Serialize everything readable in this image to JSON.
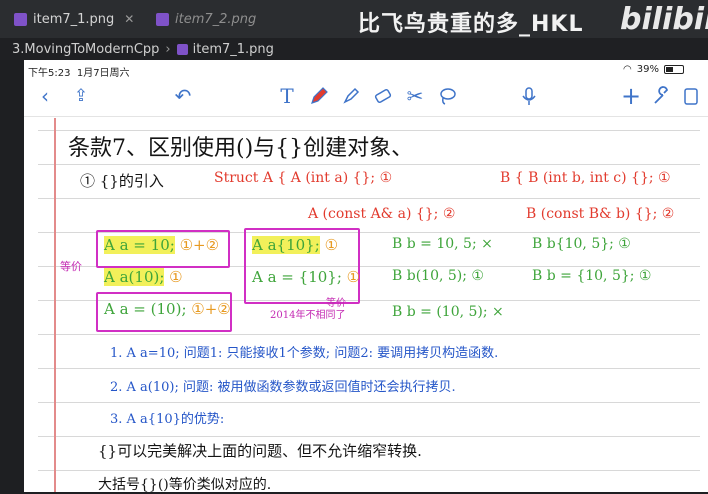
{
  "editor": {
    "tabs": [
      {
        "label": "item7_1.png",
        "active": true
      },
      {
        "label": "item7_2.png",
        "active": false
      }
    ],
    "breadcrumb": [
      "3.MovingToModernCpp",
      "item7_1.png"
    ],
    "watermark": "比飞鸟贵重的多_HKL",
    "logo": "bilibili"
  },
  "tablet": {
    "status_time": "下午5:23",
    "status_date": "1月7日周六",
    "battery": "39%",
    "toolbar_icons": [
      "back-icon",
      "share-icon",
      "undo-icon",
      "text-icon",
      "pen-icon",
      "highlighter-icon",
      "eraser-icon",
      "scissors-icon",
      "lasso-icon",
      "mic-icon",
      "add-icon",
      "wrench-icon",
      "pages-icon"
    ]
  },
  "note": {
    "title": "条款7、区别使用()与{}创建对象、",
    "section1": "① {}的引入",
    "struct_a": "Struct A { A (int a) {}; ①",
    "struct_a_copy": "A (const A& a) {}; ②",
    "struct_b": "B { B (int b, int c) {}; ①",
    "struct_b_copy": "B (const B& b) {}; ②",
    "init_a1": "A a = 10;",
    "init_a2": "A a(10);",
    "init_a3": "A a = (10);",
    "init_a4": "A a{10};",
    "init_a5": "A a = {10};",
    "mark_12": "①+②",
    "mark_1": "①",
    "side_label": "等价",
    "side_label2": "等价",
    "year_note": "2014年不相同了",
    "init_b1": "B b = 10, 5; ×",
    "init_b2": "B b(10, 5); ①",
    "init_b3": "B b = (10, 5); ×",
    "init_b4": "B b{10, 5}; ①",
    "init_b5": "B b = {10, 5}; ①",
    "issue1": "1. A a=10;  问题1: 只能接收1个参数; 问题2: 要调用拷贝构造函数.",
    "issue2": "2. A a(10);  问题: 被用做函数参数或返回值时还会执行拷贝.",
    "issue3": "3. A a{10}的优势:",
    "summary": "{}可以完美解决上面的问题、但不允许缩窄转换.",
    "last_line": "大括号{}()等价类似对应的."
  }
}
